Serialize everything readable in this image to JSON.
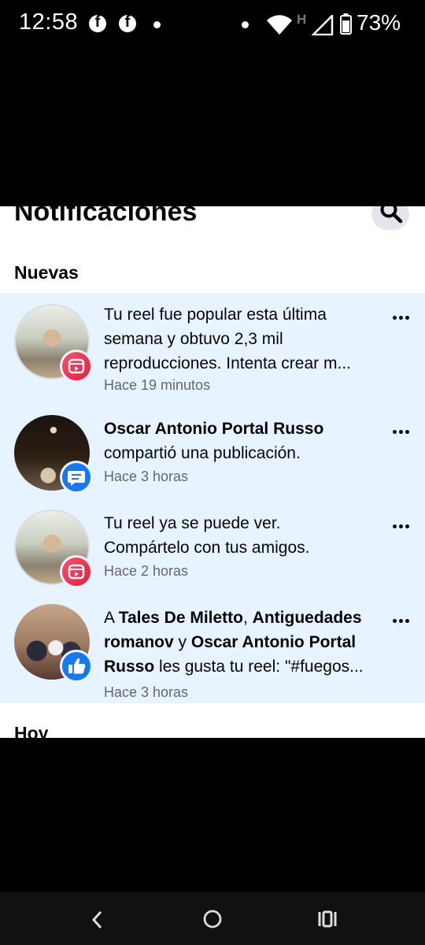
{
  "status_bar": {
    "time": "12:58",
    "network": "H",
    "battery": "73%",
    "icons": [
      "facebook-icon",
      "facebook-icon",
      "dot-icon",
      "dot-icon",
      "wifi-icon",
      "signal-icon",
      "battery-icon"
    ]
  },
  "header": {
    "title": "Notificaciones",
    "search_icon": "search-icon"
  },
  "sections": {
    "new_title": "Nuevas",
    "today_title": "Hoy"
  },
  "notifications": [
    {
      "line1": "Tu reel fue popular esta última",
      "line2": "semana y obtuvo 2,3 mil",
      "line3": "reproducciones. Intenta crear m...",
      "time": "Hace 19 minutos",
      "badge": "reels-icon"
    },
    {
      "name": "Oscar Antonio Portal Russo",
      "action": "compartió una publicación.",
      "time": "Hace 3 horas",
      "badge": "comment-icon"
    },
    {
      "line1": "Tu reel ya se puede ver.",
      "line2": "Compártelo con tus amigos.",
      "time": "Hace 2 horas",
      "badge": "reels-icon"
    },
    {
      "prefix": "A ",
      "name1": "Tales De Miletto",
      "sep1": ", ",
      "name2a": "Antiguedades",
      "name2b": "romanov",
      "sep2": " y ",
      "name3a": "Oscar Antonio Portal",
      "name3b": "Russo",
      "rest": " les gusta tu reel: \"#fuegos...",
      "time": "Hace 3 horas",
      "badge": "like-icon"
    }
  ],
  "colors": {
    "highlight_bg": "#e7f3ff",
    "facebook_blue": "#1877f2",
    "reel_red": "#e41e3f",
    "secondary_text": "#65676b"
  },
  "nav": {
    "back_icon": "back-icon",
    "home_icon": "home-icon",
    "recents_icon": "recents-icon"
  }
}
